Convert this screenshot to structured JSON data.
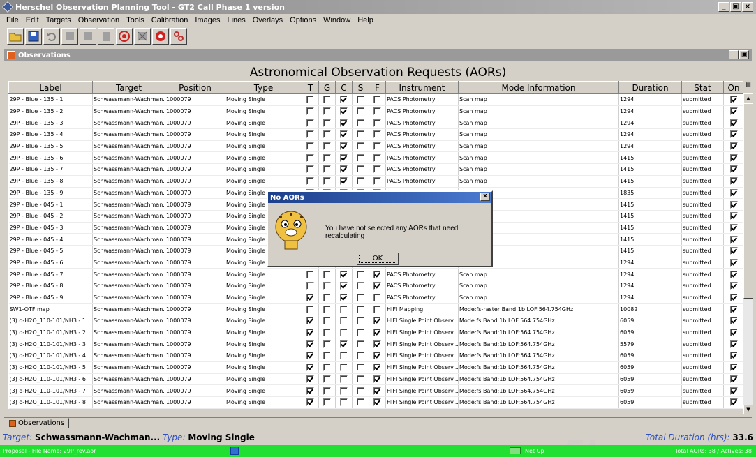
{
  "window": {
    "title": "Herschel Observation Planning Tool - GT2 Call Phase 1 version",
    "controls": [
      "_",
      "×"
    ]
  },
  "menu": [
    "File",
    "Edit",
    "Targets",
    "Observation",
    "Tools",
    "Calibration",
    "Images",
    "Lines",
    "Overlays",
    "Options",
    "Window",
    "Help"
  ],
  "toolbar": {
    "icons": [
      "open-folder-icon",
      "save-icon",
      "undo-icon",
      "cut-icon",
      "copy-icon",
      "paste-icon",
      "target-icon",
      "targets-off-icon",
      "navigate-icon",
      "link-icon"
    ]
  },
  "inner_window": {
    "title": "Observations"
  },
  "table": {
    "heading": "Astronomical Observation Requests (AORs)",
    "columns": [
      "Label",
      "Target",
      "Position",
      "Type",
      "T",
      "G",
      "C",
      "S",
      "F",
      "Instrument",
      "Mode Information",
      "Duration",
      "Stat",
      "On"
    ],
    "rows": [
      {
        "label": "29P - Blue - 135 - 1",
        "target": "Schwassmann-Wachman...",
        "position": "1000079",
        "type": "Moving Single",
        "t": false,
        "g": false,
        "c": true,
        "s": false,
        "f": false,
        "instrument": "PACS Photometry",
        "mode": "Scan map",
        "duration": "1294",
        "stat": "submitted",
        "on": true
      },
      {
        "label": "29P - Blue - 135 - 2",
        "target": "Schwassmann-Wachman...",
        "position": "1000079",
        "type": "Moving Single",
        "t": false,
        "g": false,
        "c": true,
        "s": false,
        "f": false,
        "instrument": "PACS Photometry",
        "mode": "Scan map",
        "duration": "1294",
        "stat": "submitted",
        "on": true
      },
      {
        "label": "29P - Blue - 135 - 3",
        "target": "Schwassmann-Wachman...",
        "position": "1000079",
        "type": "Moving Single",
        "t": false,
        "g": false,
        "c": true,
        "s": false,
        "f": false,
        "instrument": "PACS Photometry",
        "mode": "Scan map",
        "duration": "1294",
        "stat": "submitted",
        "on": true
      },
      {
        "label": "29P - Blue - 135 - 4",
        "target": "Schwassmann-Wachman...",
        "position": "1000079",
        "type": "Moving Single",
        "t": false,
        "g": false,
        "c": true,
        "s": false,
        "f": false,
        "instrument": "PACS Photometry",
        "mode": "Scan map",
        "duration": "1294",
        "stat": "submitted",
        "on": true
      },
      {
        "label": "29P - Blue - 135 - 5",
        "target": "Schwassmann-Wachman...",
        "position": "1000079",
        "type": "Moving Single",
        "t": false,
        "g": false,
        "c": true,
        "s": false,
        "f": false,
        "instrument": "PACS Photometry",
        "mode": "Scan map",
        "duration": "1294",
        "stat": "submitted",
        "on": true
      },
      {
        "label": "29P - Blue - 135 - 6",
        "target": "Schwassmann-Wachman...",
        "position": "1000079",
        "type": "Moving Single",
        "t": false,
        "g": false,
        "c": true,
        "s": false,
        "f": false,
        "instrument": "PACS Photometry",
        "mode": "Scan map",
        "duration": "1415",
        "stat": "submitted",
        "on": true
      },
      {
        "label": "29P - Blue - 135 - 7",
        "target": "Schwassmann-Wachman...",
        "position": "1000079",
        "type": "Moving Single",
        "t": false,
        "g": false,
        "c": true,
        "s": false,
        "f": false,
        "instrument": "PACS Photometry",
        "mode": "Scan map",
        "duration": "1415",
        "stat": "submitted",
        "on": true
      },
      {
        "label": "29P - Blue - 135 - 8",
        "target": "Schwassmann-Wachman...",
        "position": "1000079",
        "type": "Moving Single",
        "t": false,
        "g": false,
        "c": true,
        "s": false,
        "f": false,
        "instrument": "PACS Photometry",
        "mode": "Scan map",
        "duration": "1415",
        "stat": "submitted",
        "on": true
      },
      {
        "label": "29P - Blue - 135 - 9",
        "target": "Schwassmann-Wachman...",
        "position": "1000079",
        "type": "Moving Single",
        "t": false,
        "g": false,
        "c": true,
        "s": false,
        "f": false,
        "instrument": "",
        "mode": "",
        "duration": "1835",
        "stat": "submitted",
        "on": true
      },
      {
        "label": "29P - Blue - 045 - 1",
        "target": "Schwassmann-Wachman...",
        "position": "1000079",
        "type": "Moving Single",
        "t": false,
        "g": false,
        "c": true,
        "s": false,
        "f": false,
        "instrument": "",
        "mode": "",
        "duration": "1415",
        "stat": "submitted",
        "on": true
      },
      {
        "label": "29P - Blue - 045 - 2",
        "target": "Schwassmann-Wachman...",
        "position": "1000079",
        "type": "Moving Single",
        "t": false,
        "g": false,
        "c": true,
        "s": false,
        "f": false,
        "instrument": "",
        "mode": "",
        "duration": "1415",
        "stat": "submitted",
        "on": true
      },
      {
        "label": "29P - Blue - 045 - 3",
        "target": "Schwassmann-Wachman...",
        "position": "1000079",
        "type": "Moving Single",
        "t": false,
        "g": false,
        "c": true,
        "s": false,
        "f": false,
        "instrument": "",
        "mode": "",
        "duration": "1415",
        "stat": "submitted",
        "on": true
      },
      {
        "label": "29P - Blue - 045 - 4",
        "target": "Schwassmann-Wachman...",
        "position": "1000079",
        "type": "Moving Single",
        "t": false,
        "g": false,
        "c": true,
        "s": false,
        "f": false,
        "instrument": "",
        "mode": "",
        "duration": "1415",
        "stat": "submitted",
        "on": true
      },
      {
        "label": "29P - Blue - 045 - 5",
        "target": "Schwassmann-Wachman...",
        "position": "1000079",
        "type": "Moving Single",
        "t": false,
        "g": false,
        "c": true,
        "s": false,
        "f": false,
        "instrument": "",
        "mode": "",
        "duration": "1415",
        "stat": "submitted",
        "on": true
      },
      {
        "label": "29P - Blue - 045 - 6",
        "target": "Schwassmann-Wachman...",
        "position": "1000079",
        "type": "Moving Single",
        "t": false,
        "g": false,
        "c": true,
        "s": false,
        "f": false,
        "instrument": "",
        "mode": "",
        "duration": "1294",
        "stat": "submitted",
        "on": true
      },
      {
        "label": "29P - Blue - 045 - 7",
        "target": "Schwassmann-Wachman...",
        "position": "1000079",
        "type": "Moving Single",
        "t": false,
        "g": false,
        "c": true,
        "s": false,
        "f": true,
        "instrument": "PACS Photometry",
        "mode": "Scan map",
        "duration": "1294",
        "stat": "submitted",
        "on": true
      },
      {
        "label": "29P - Blue - 045 - 8",
        "target": "Schwassmann-Wachman...",
        "position": "1000079",
        "type": "Moving Single",
        "t": false,
        "g": false,
        "c": true,
        "s": false,
        "f": true,
        "instrument": "PACS Photometry",
        "mode": "Scan map",
        "duration": "1294",
        "stat": "submitted",
        "on": true
      },
      {
        "label": "29P - Blue - 045 - 9",
        "target": "Schwassmann-Wachman...",
        "position": "1000079",
        "type": "Moving Single",
        "t": true,
        "g": false,
        "c": true,
        "s": false,
        "f": false,
        "instrument": "PACS Photometry",
        "mode": "Scan map",
        "duration": "1294",
        "stat": "submitted",
        "on": true
      },
      {
        "label": "SW1-OTF map",
        "target": "Schwassmann-Wachman...",
        "position": "1000079",
        "type": "Moving Single",
        "t": false,
        "g": false,
        "c": false,
        "s": false,
        "f": false,
        "instrument": "HIFI Mapping",
        "mode": "Mode:fs-raster Band:1b LOF:564.754GHz",
        "duration": "10082",
        "stat": "submitted",
        "on": true
      },
      {
        "label": "(3) o-H2O_110-101/NH3 - 1",
        "target": "Schwassmann-Wachman...",
        "position": "1000079",
        "type": "Moving Single",
        "t": true,
        "g": false,
        "c": false,
        "s": false,
        "f": true,
        "instrument": "HIFI Single Point Observ...",
        "mode": "Mode:fs Band:1b LOF:564.754GHz",
        "duration": "6059",
        "stat": "submitted",
        "on": true
      },
      {
        "label": "(3) o-H2O_110-101/NH3 - 2",
        "target": "Schwassmann-Wachman...",
        "position": "1000079",
        "type": "Moving Single",
        "t": true,
        "g": false,
        "c": false,
        "s": false,
        "f": true,
        "instrument": "HIFI Single Point Observ...",
        "mode": "Mode:fs Band:1b LOF:564.754GHz",
        "duration": "6059",
        "stat": "submitted",
        "on": true
      },
      {
        "label": "(3) o-H2O_110-101/NH3 - 3",
        "target": "Schwassmann-Wachman...",
        "position": "1000079",
        "type": "Moving Single",
        "t": true,
        "g": false,
        "c": true,
        "s": false,
        "f": true,
        "instrument": "HIFI Single Point Observ...",
        "mode": "Mode:fs Band:1b LOF:564.754GHz",
        "duration": "5579",
        "stat": "submitted",
        "on": true
      },
      {
        "label": "(3) o-H2O_110-101/NH3 - 4",
        "target": "Schwassmann-Wachman...",
        "position": "1000079",
        "type": "Moving Single",
        "t": true,
        "g": false,
        "c": false,
        "s": false,
        "f": true,
        "instrument": "HIFI Single Point Observ...",
        "mode": "Mode:fs Band:1b LOF:564.754GHz",
        "duration": "6059",
        "stat": "submitted",
        "on": true
      },
      {
        "label": "(3) o-H2O_110-101/NH3 - 5",
        "target": "Schwassmann-Wachman...",
        "position": "1000079",
        "type": "Moving Single",
        "t": true,
        "g": false,
        "c": false,
        "s": false,
        "f": true,
        "instrument": "HIFI Single Point Observ...",
        "mode": "Mode:fs Band:1b LOF:564.754GHz",
        "duration": "6059",
        "stat": "submitted",
        "on": true
      },
      {
        "label": "(3) o-H2O_110-101/NH3 - 6",
        "target": "Schwassmann-Wachman...",
        "position": "1000079",
        "type": "Moving Single",
        "t": true,
        "g": false,
        "c": false,
        "s": false,
        "f": true,
        "instrument": "HIFI Single Point Observ...",
        "mode": "Mode:fs Band:1b LOF:564.754GHz",
        "duration": "6059",
        "stat": "submitted",
        "on": true
      },
      {
        "label": "(3) o-H2O_110-101/NH3 - 7",
        "target": "Schwassmann-Wachman...",
        "position": "1000079",
        "type": "Moving Single",
        "t": true,
        "g": false,
        "c": false,
        "s": false,
        "f": true,
        "instrument": "HIFI Single Point Observ...",
        "mode": "Mode:fs Band:1b LOF:564.754GHz",
        "duration": "6059",
        "stat": "submitted",
        "on": true
      },
      {
        "label": "(3) o-H2O_110-101/NH3 - 8",
        "target": "Schwassmann-Wachman...",
        "position": "1000079",
        "type": "Moving Single",
        "t": true,
        "g": false,
        "c": false,
        "s": false,
        "f": true,
        "instrument": "HIFI Single Point Observ...",
        "mode": "Mode:fs Band:1b LOF:564.754GHz",
        "duration": "6059",
        "stat": "submitted",
        "on": true
      }
    ]
  },
  "dialog": {
    "title": "No AORs",
    "close": "x",
    "message": "You have not selected any AORs that need recalculating",
    "ok_label": "OK",
    "icon": "cheetah-mascot-icon"
  },
  "tab": {
    "label": "Observations"
  },
  "info": {
    "target_label": "Target:",
    "target_value": "Schwassmann-Wachman...",
    "type_label": "Type:",
    "type_value": "Moving Single",
    "total_label": "Total Duration (hrs):",
    "total_value": "33.6"
  },
  "status": {
    "file": "Proposal - File Name: 29P_rev.aor",
    "net": "Net Up",
    "counts": "Total AORs: 38  / Actives: 38",
    "color": "#22e032"
  }
}
